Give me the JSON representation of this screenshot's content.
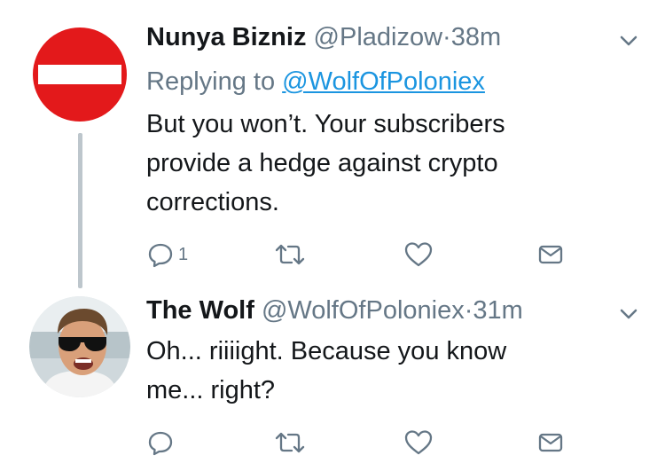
{
  "tweets": [
    {
      "name": "Nunya Bizniz",
      "handle": "@Pladizow",
      "dot": "·",
      "time": "38m",
      "replying_prefix": "Replying to ",
      "replying_to": "@WolfOfPoloniex",
      "text_lines": [
        "But you won’t. Your subscribers",
        "provide a hedge against crypto",
        "corrections."
      ],
      "reply_count": "1",
      "avatar_icon": "no-entry-sign-icon"
    },
    {
      "name": "The Wolf",
      "handle": "@WolfOfPoloniex",
      "dot": "·",
      "time": "31m",
      "text_lines": [
        "Oh... riiiight. Because you know",
        "me... right?"
      ],
      "reply_count": "",
      "avatar_icon": "person-sunglasses-photo"
    }
  ],
  "colors": {
    "name": "#14171a",
    "secondary": "#657786",
    "link": "#1b95e0",
    "no_entry_red": "#e3191b",
    "thread_line": "#bdc6cc"
  }
}
